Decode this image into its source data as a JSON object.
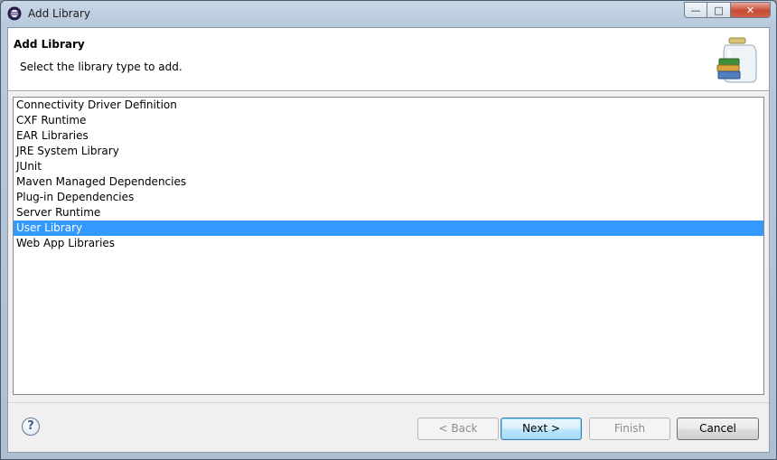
{
  "window": {
    "title": "Add Library",
    "controls": {
      "minimize": "—",
      "maximize": "□",
      "close": "✕"
    }
  },
  "header": {
    "title": "Add Library",
    "message": "Select the library type to add."
  },
  "library_types": [
    {
      "label": "Connectivity Driver Definition",
      "selected": false
    },
    {
      "label": "CXF Runtime",
      "selected": false
    },
    {
      "label": "EAR Libraries",
      "selected": false
    },
    {
      "label": "JRE System Library",
      "selected": false
    },
    {
      "label": "JUnit",
      "selected": false
    },
    {
      "label": "Maven Managed Dependencies",
      "selected": false
    },
    {
      "label": "Plug-in Dependencies",
      "selected": false
    },
    {
      "label": "Server Runtime",
      "selected": false
    },
    {
      "label": "User Library",
      "selected": true
    },
    {
      "label": "Web App Libraries",
      "selected": false
    }
  ],
  "footer": {
    "help_glyph": "?",
    "back_label": "< Back",
    "next_label": "Next >",
    "finish_label": "Finish",
    "cancel_label": "Cancel"
  },
  "colors": {
    "selection": "#3399ff",
    "default_button_border": "#3c7fb1"
  },
  "icons": [
    "eclipse-app-icon",
    "library-jar-books-icon",
    "help-icon"
  ]
}
